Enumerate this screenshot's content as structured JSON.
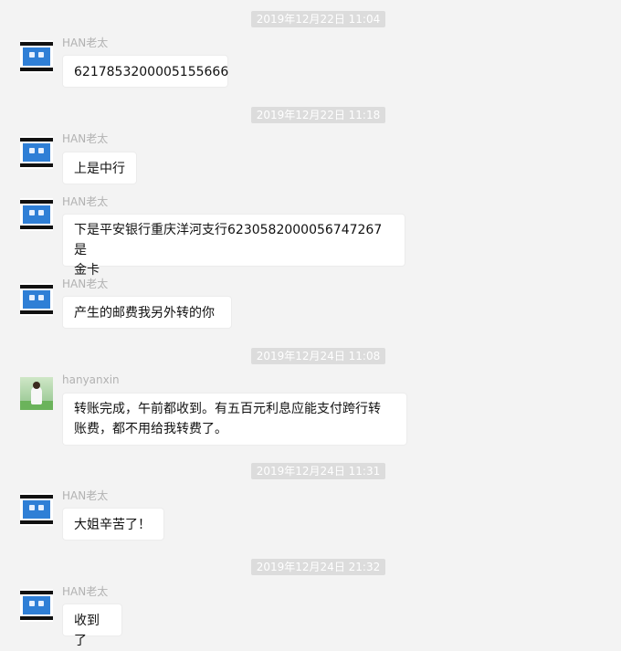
{
  "messages": [
    {
      "timestamp": "2019年12月22日 11:04",
      "sender": "HAN老太",
      "text": "6217853200005155666"
    },
    {
      "timestamp": "2019年12月22日 11:18",
      "sender": "HAN老太",
      "text": "上是中行"
    },
    {
      "sender": "HAN老太",
      "text_line1": "下是平安银行重庆洋河支行6230582000056747267是",
      "text_line2": "金卡"
    },
    {
      "sender": "HAN老太",
      "text": "产生的邮费我另外转的你"
    },
    {
      "timestamp": "2019年12月24日 11:08",
      "sender": "hanyanxin",
      "text_line1": "转账完成，午前都收到。有五百元利息应能支付跨行转",
      "text_line2": "账费，都不用给我转费了。"
    },
    {
      "timestamp": "2019年12月24日 11:31",
      "sender": "HAN老太",
      "text": "大姐辛苦了！"
    },
    {
      "timestamp": "2019年12月24日 21:32",
      "sender": "HAN老太",
      "text": "收到了"
    }
  ],
  "icons": {
    "han_avatar": "computer-screen-avatar",
    "hanyanxin_avatar": "person-in-field-avatar"
  }
}
